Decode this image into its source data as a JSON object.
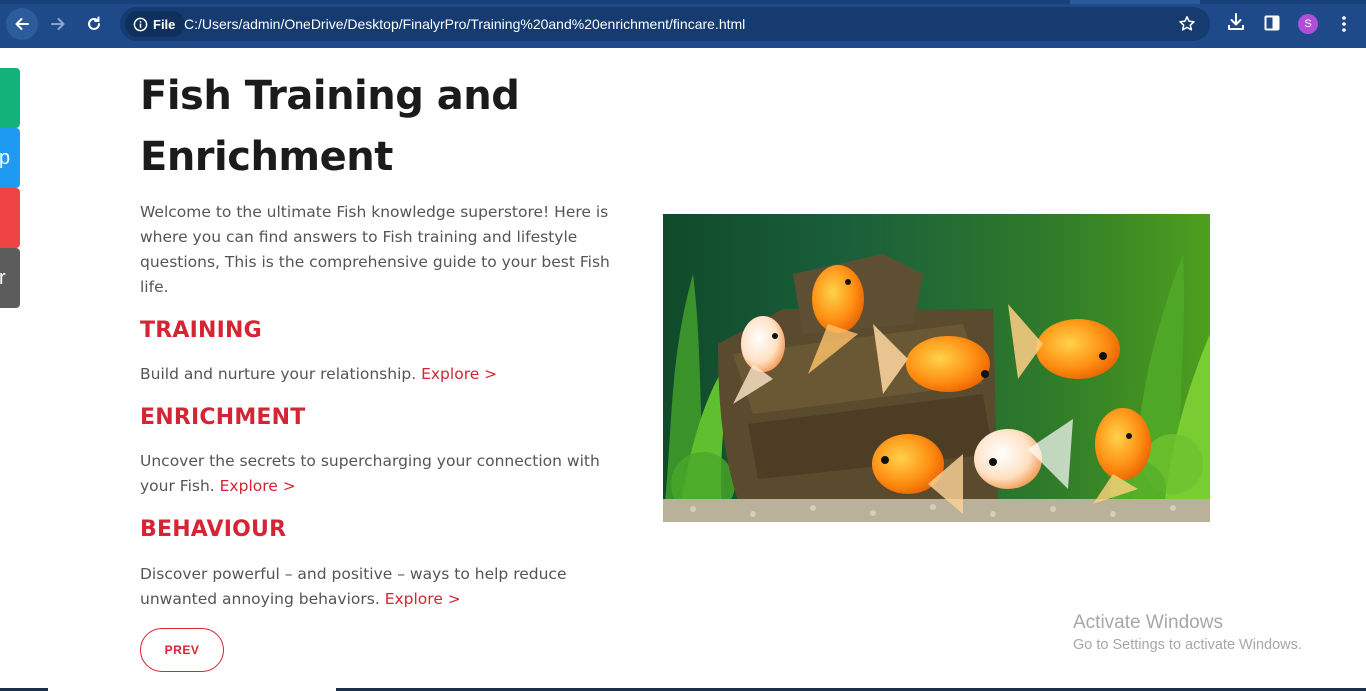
{
  "browser": {
    "file_chip_label": "File",
    "url": "C:/Users/admin/OneDrive/Desktop/FinalyrPro/Training%20and%20enrichment/fincare.html",
    "profile_initial": "S",
    "colors": {
      "toolbar": "#1e4a8a",
      "omnibox": "#163b70",
      "avatar": "#b04fd6"
    }
  },
  "side_share": [
    {
      "icon": "share-green-icon",
      "glyph": "",
      "color": "#12b27a"
    },
    {
      "icon": "share-blue-icon",
      "glyph": "p",
      "color": "#1e9af0"
    },
    {
      "icon": "share-red-icon",
      "glyph": "",
      "color": "#ef4444"
    },
    {
      "icon": "share-grey-icon",
      "glyph": "r",
      "color": "#5c5c5c"
    }
  ],
  "page": {
    "title": "Fish Training and Enrichment",
    "intro": "Welcome to the ultimate Fish knowledge superstore! Here is where you can find answers to Fish training and lifestyle questions, This is the comprehensive guide to your best Fish life.",
    "sections": [
      {
        "heading": "TRAINING",
        "text": "Build and nurture your relationship. ",
        "link": "Explore >"
      },
      {
        "heading": "ENRICHMENT",
        "text": "Uncover the secrets to supercharging your connection with your Fish. ",
        "link": "Explore >"
      },
      {
        "heading": "BEHAVIOUR",
        "text": "Discover powerful – and positive – ways to help reduce unwanted annoying behaviors. ",
        "link": "Explore >"
      }
    ],
    "prev_button": "PREV",
    "accent_color": "#d52434",
    "hero_image": "goldfish-aquarium"
  },
  "watermark": {
    "line1": "Activate Windows",
    "line2": "Go to Settings to activate Windows."
  }
}
